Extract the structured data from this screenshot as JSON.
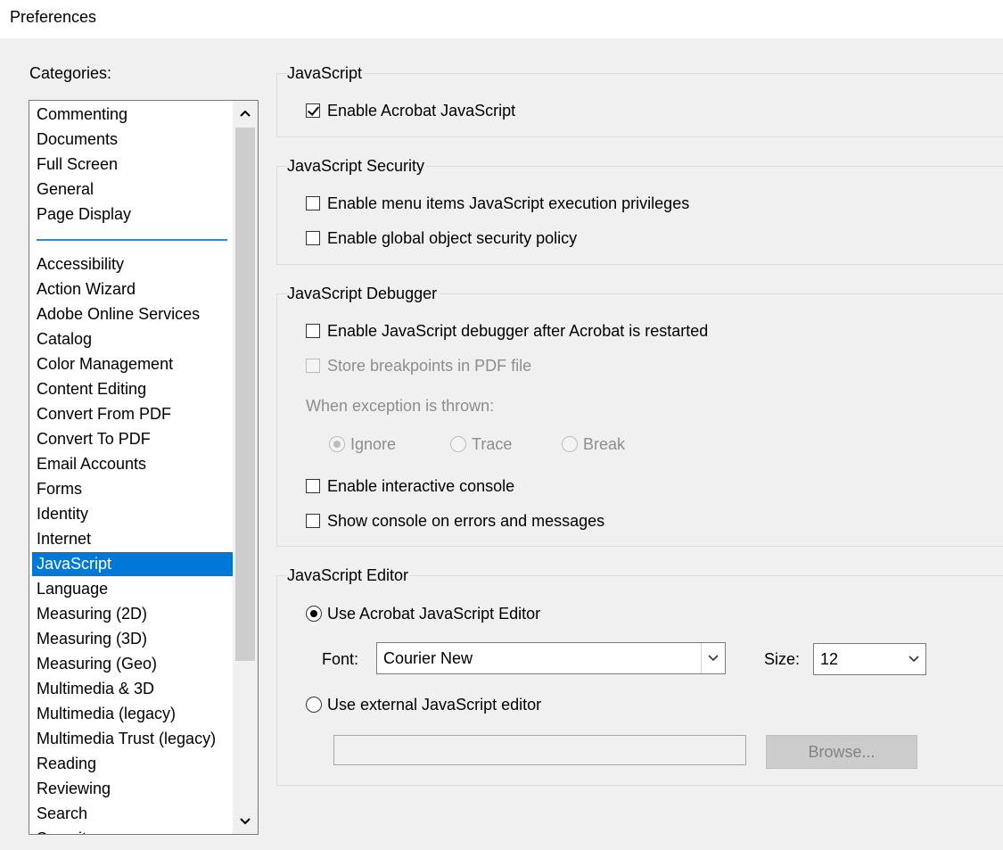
{
  "window": {
    "title": "Preferences"
  },
  "categories": {
    "label": "Categories:",
    "top_items": [
      "Commenting",
      "Documents",
      "Full Screen",
      "General",
      "Page Display"
    ],
    "items": [
      "Accessibility",
      "Action Wizard",
      "Adobe Online Services",
      "Catalog",
      "Color Management",
      "Content Editing",
      "Convert From PDF",
      "Convert To PDF",
      "Email Accounts",
      "Forms",
      "Identity",
      "Internet",
      "JavaScript",
      "Language",
      "Measuring (2D)",
      "Measuring (3D)",
      "Measuring (Geo)",
      "Multimedia & 3D",
      "Multimedia (legacy)",
      "Multimedia Trust (legacy)",
      "Reading",
      "Reviewing",
      "Search",
      "Security"
    ],
    "selected": "JavaScript"
  },
  "javascript": {
    "title": "JavaScript",
    "enable_label": "Enable Acrobat JavaScript",
    "enable_checked": true
  },
  "security": {
    "title": "JavaScript Security",
    "menu_items_label": "Enable menu items JavaScript execution privileges",
    "menu_items_checked": false,
    "global_policy_label": "Enable global object security policy",
    "global_policy_checked": false
  },
  "debugger": {
    "title": "JavaScript Debugger",
    "enable_debugger_label": "Enable JavaScript debugger after Acrobat is restarted",
    "enable_debugger_checked": false,
    "store_breakpoints_label": "Store breakpoints in PDF file",
    "store_breakpoints_checked": false,
    "exception_label": "When exception is thrown:",
    "exception_options": [
      "Ignore",
      "Trace",
      "Break"
    ],
    "exception_selected": "Ignore",
    "interactive_console_label": "Enable interactive console",
    "interactive_console_checked": false,
    "show_console_label": "Show console on errors and messages",
    "show_console_checked": false
  },
  "editor": {
    "title": "JavaScript Editor",
    "use_acrobat_label": "Use Acrobat JavaScript Editor",
    "use_external_label": "Use external JavaScript editor",
    "selected": "acrobat",
    "font_label": "Font:",
    "font_value": "Courier New",
    "size_label": "Size:",
    "size_value": "12",
    "external_path_value": "",
    "browse_label": "Browse..."
  },
  "icons": {
    "scroll_up": "chevron-up-icon",
    "scroll_down": "chevron-down-icon",
    "dropdown": "chevron-down-icon"
  }
}
